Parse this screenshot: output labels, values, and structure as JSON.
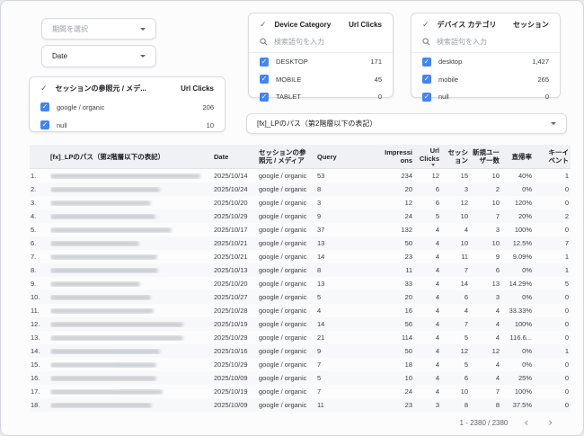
{
  "colors": {
    "accent": "#4285f4",
    "table_header_bg": "#eff1f4",
    "row_alt": "#f7f8fa"
  },
  "controls": {
    "period": {
      "placeholder": "期間を選択"
    },
    "date": {
      "label": "Date"
    },
    "lp_path": {
      "label": "[fx]_LPのパス（第2階層以下の表記）"
    }
  },
  "filters": [
    {
      "title": "セッションの参照元 / メデ...",
      "metric": "Url Clicks",
      "items": [
        {
          "label": "google / organic",
          "value": "206"
        },
        {
          "label": "null",
          "value": "10"
        }
      ]
    },
    {
      "title": "Device Category",
      "metric": "Url Clicks",
      "search_placeholder": "検索語句を入力",
      "items": [
        {
          "label": "DESKTOP",
          "value": "171"
        },
        {
          "label": "MOBILE",
          "value": "45"
        },
        {
          "label": "TABLET",
          "value": "0"
        }
      ]
    },
    {
      "title": "デバイス カテゴリ",
      "metric": "セッション",
      "search_placeholder": "検索語句を入力",
      "items": [
        {
          "label": "desktop",
          "value": "1,427"
        },
        {
          "label": "mobile",
          "value": "265"
        },
        {
          "label": "null",
          "value": "0"
        }
      ]
    }
  ],
  "table": {
    "columns": [
      {
        "key": "index",
        "label": "",
        "align": "left"
      },
      {
        "key": "lp_path",
        "label": "[fx]_LPのパス（第2階層以下の表記）",
        "align": "left"
      },
      {
        "key": "date",
        "label": "Date",
        "align": "left"
      },
      {
        "key": "source",
        "label": "セッションの参\n照元 / メディア",
        "align": "left"
      },
      {
        "key": "query",
        "label": "Query",
        "align": "left"
      },
      {
        "key": "impressions",
        "label": "Impressi\nons",
        "align": "right"
      },
      {
        "key": "url_clicks",
        "label": "Url\nClicks",
        "align": "right",
        "sorted": "desc"
      },
      {
        "key": "sessions",
        "label": "セッシ\nョン",
        "align": "right"
      },
      {
        "key": "new_users",
        "label": "新規ユー\nザー数",
        "align": "right"
      },
      {
        "key": "bounce_rate",
        "label": "直帰率",
        "align": "right"
      },
      {
        "key": "key_events",
        "label": "キーイ\nベント",
        "align": "right"
      }
    ],
    "rows": [
      {
        "num": "1.",
        "blur_width": 167,
        "date": "2025/10/14",
        "source": "google / organic",
        "query": "53",
        "impressions": "234",
        "url_clicks": "12",
        "sessions": "15",
        "new_users": "10",
        "bounce_rate": "40%",
        "key_events": "1"
      },
      {
        "num": "2.",
        "blur_width": 122,
        "date": "2025/10/24",
        "source": "google / organic",
        "query": "8",
        "impressions": "20",
        "url_clicks": "6",
        "sessions": "3",
        "new_users": "2",
        "bounce_rate": "0%",
        "key_events": "0"
      },
      {
        "num": "3.",
        "blur_width": 112,
        "date": "2025/10/20",
        "source": "google / organic",
        "query": "3",
        "impressions": "12",
        "url_clicks": "6",
        "sessions": "12",
        "new_users": "10",
        "bounce_rate": "120%",
        "key_events": "0"
      },
      {
        "num": "4.",
        "blur_width": 117,
        "date": "2025/10/29",
        "source": "google / organic",
        "query": "9",
        "impressions": "24",
        "url_clicks": "5",
        "sessions": "10",
        "new_users": "7",
        "bounce_rate": "20%",
        "key_events": "2"
      },
      {
        "num": "5.",
        "blur_width": 135,
        "date": "2025/10/17",
        "source": "google / organic",
        "query": "37",
        "impressions": "132",
        "url_clicks": "4",
        "sessions": "4",
        "new_users": "3",
        "bounce_rate": "100%",
        "key_events": "0"
      },
      {
        "num": "6.",
        "blur_width": 99,
        "date": "2025/10/21",
        "source": "google / organic",
        "query": "13",
        "impressions": "50",
        "url_clicks": "4",
        "sessions": "10",
        "new_users": "10",
        "bounce_rate": "12.5%",
        "key_events": "7"
      },
      {
        "num": "7.",
        "blur_width": 119,
        "date": "2025/10/21",
        "source": "google / organic",
        "query": "14",
        "impressions": "23",
        "url_clicks": "4",
        "sessions": "11",
        "new_users": "9",
        "bounce_rate": "9.09%",
        "key_events": "1"
      },
      {
        "num": "8.",
        "blur_width": 120,
        "date": "2025/10/13",
        "source": "google / organic",
        "query": "8",
        "impressions": "11",
        "url_clicks": "4",
        "sessions": "7",
        "new_users": "6",
        "bounce_rate": "0%",
        "key_events": "1"
      },
      {
        "num": "9.",
        "blur_width": 100,
        "date": "2025/10/20",
        "source": "google / organic",
        "query": "13",
        "impressions": "33",
        "url_clicks": "4",
        "sessions": "14",
        "new_users": "13",
        "bounce_rate": "14.29%",
        "key_events": "5"
      },
      {
        "num": "10.",
        "blur_width": 112,
        "date": "2025/10/27",
        "source": "google / organic",
        "query": "5",
        "impressions": "20",
        "url_clicks": "4",
        "sessions": "6",
        "new_users": "3",
        "bounce_rate": "0%",
        "key_events": "0"
      },
      {
        "num": "11.",
        "blur_width": 115,
        "date": "2025/10/28",
        "source": "google / organic",
        "query": "4",
        "impressions": "16",
        "url_clicks": "4",
        "sessions": "4",
        "new_users": "4",
        "bounce_rate": "33.33%",
        "key_events": "0"
      },
      {
        "num": "12.",
        "blur_width": 148,
        "date": "2025/10/19",
        "source": "google / organic",
        "query": "14",
        "impressions": "56",
        "url_clicks": "4",
        "sessions": "7",
        "new_users": "4",
        "bounce_rate": "100%",
        "key_events": "0"
      },
      {
        "num": "13.",
        "blur_width": 148,
        "date": "2025/10/29",
        "source": "google / organic",
        "query": "21",
        "impressions": "114",
        "url_clicks": "4",
        "sessions": "5",
        "new_users": "4",
        "bounce_rate": "116.6...",
        "key_events": "0"
      },
      {
        "num": "14.",
        "blur_width": 122,
        "date": "2025/10/16",
        "source": "google / organic",
        "query": "9",
        "impressions": "50",
        "url_clicks": "4",
        "sessions": "12",
        "new_users": "12",
        "bounce_rate": "0%",
        "key_events": "1"
      },
      {
        "num": "15.",
        "blur_width": 118,
        "date": "2025/10/29",
        "source": "google / organic",
        "query": "7",
        "impressions": "18",
        "url_clicks": "4",
        "sessions": "5",
        "new_users": "4",
        "bounce_rate": "0%",
        "key_events": "0"
      },
      {
        "num": "16.",
        "blur_width": 118,
        "date": "2025/10/09",
        "source": "google / organic",
        "query": "5",
        "impressions": "10",
        "url_clicks": "4",
        "sessions": "6",
        "new_users": "4",
        "bounce_rate": "25%",
        "key_events": "0"
      },
      {
        "num": "17.",
        "blur_width": 125,
        "date": "2025/10/19",
        "source": "google / organic",
        "query": "7",
        "impressions": "24",
        "url_clicks": "4",
        "sessions": "10",
        "new_users": "7",
        "bounce_rate": "100%",
        "key_events": "0"
      },
      {
        "num": "18.",
        "blur_width": 113,
        "date": "2025/10/09",
        "source": "google / organic",
        "query": "11",
        "impressions": "23",
        "url_clicks": "3",
        "sessions": "8",
        "new_users": "8",
        "bounce_rate": "37.5%",
        "key_events": "0"
      }
    ],
    "pagination": {
      "range_label": "1 - 2380 / 2380",
      "prev_icon": "‹",
      "next_icon": "›"
    }
  }
}
